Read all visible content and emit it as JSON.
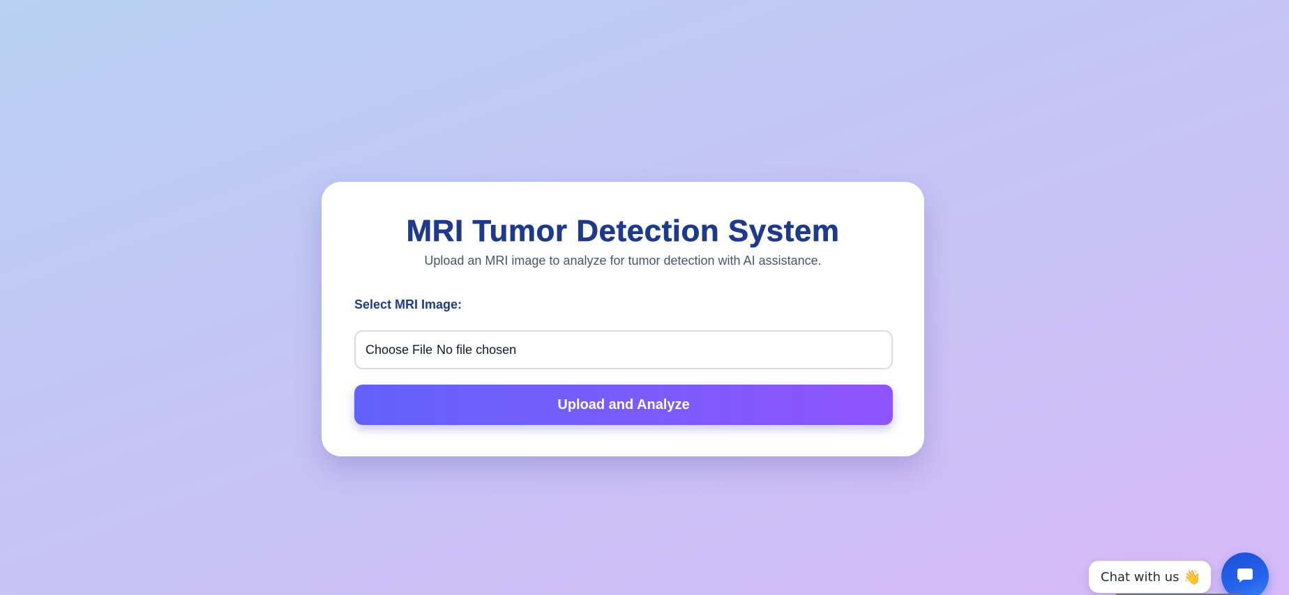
{
  "card": {
    "title": "MRI Tumor Detection System",
    "subtitle": "Upload an MRI image to analyze for tumor detection with AI assistance.",
    "field_label": "Select MRI Image:",
    "file_input": {
      "button_label": "Choose File",
      "status": "No file chosen"
    },
    "submit_label": "Upload and Analyze"
  },
  "chat": {
    "label": "Chat with us",
    "emoji": "👋",
    "fab_icon": "chat-bubble-icon"
  },
  "colors": {
    "title": "#1e3a8a",
    "button_gradient_start": "#6361fb",
    "button_gradient_end": "#8f53fb",
    "chat_fab": "#2563eb"
  }
}
